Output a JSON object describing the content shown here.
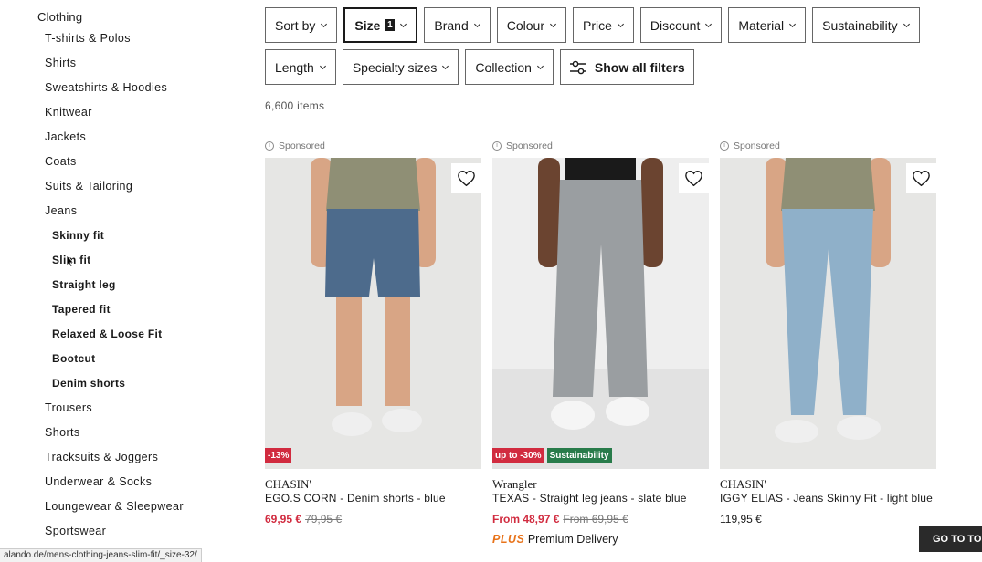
{
  "sidebar": {
    "root": "Clothing",
    "items": [
      {
        "label": "T-shirts & Polos",
        "sub": false
      },
      {
        "label": "Shirts",
        "sub": false
      },
      {
        "label": "Sweatshirts & Hoodies",
        "sub": false
      },
      {
        "label": "Knitwear",
        "sub": false
      },
      {
        "label": "Jackets",
        "sub": false
      },
      {
        "label": "Coats",
        "sub": false
      },
      {
        "label": "Suits & Tailoring",
        "sub": false
      },
      {
        "label": "Jeans",
        "sub": false
      },
      {
        "label": "Skinny fit",
        "sub": true
      },
      {
        "label": "Slim fit",
        "sub": true
      },
      {
        "label": "Straight leg",
        "sub": true
      },
      {
        "label": "Tapered fit",
        "sub": true
      },
      {
        "label": "Relaxed & Loose Fit",
        "sub": true
      },
      {
        "label": "Bootcut",
        "sub": true
      },
      {
        "label": "Denim shorts",
        "sub": true
      },
      {
        "label": "Trousers",
        "sub": false
      },
      {
        "label": "Shorts",
        "sub": false
      },
      {
        "label": "Tracksuits & Joggers",
        "sub": false
      },
      {
        "label": "Underwear & Socks",
        "sub": false
      },
      {
        "label": "Loungewear & Sleepwear",
        "sub": false
      },
      {
        "label": "Sportswear",
        "sub": false
      }
    ]
  },
  "filters": {
    "row1": [
      {
        "label": "Sort by",
        "active": false,
        "badge": ""
      },
      {
        "label": "Size",
        "active": true,
        "badge": "1"
      },
      {
        "label": "Brand",
        "active": false,
        "badge": ""
      },
      {
        "label": "Colour",
        "active": false,
        "badge": ""
      },
      {
        "label": "Price",
        "active": false,
        "badge": ""
      },
      {
        "label": "Discount",
        "active": false,
        "badge": ""
      },
      {
        "label": "Material",
        "active": false,
        "badge": ""
      },
      {
        "label": "Sustainability",
        "active": false,
        "badge": ""
      }
    ],
    "row2": [
      {
        "label": "Length"
      },
      {
        "label": "Specialty sizes"
      },
      {
        "label": "Collection"
      }
    ],
    "show_all": "Show all filters"
  },
  "item_count": "6,600 items",
  "products": [
    {
      "sponsored": "Sponsored",
      "brand": "CHASIN'",
      "name": "EGO.S CORN - Denim shorts - blue",
      "price_new": "69,95 €",
      "price_old": "79,95 €",
      "price_regular": "",
      "tags": [
        {
          "text": "-13%",
          "color": "red"
        }
      ],
      "plus": "",
      "plus_text": "",
      "style": "shorts",
      "colors": {
        "bg": "#e6e6e4",
        "shirt": "#8f8f75",
        "denim": "#4d6b8c",
        "skin": "#d8a585",
        "shoe": "#efefef"
      }
    },
    {
      "sponsored": "Sponsored",
      "brand": "Wrangler",
      "name": "TEXAS - Straight leg jeans - slate blue",
      "price_new": "From 48,97 €",
      "price_old": "From 69,95 €",
      "price_regular": "",
      "tags": [
        {
          "text": "up to -30%",
          "color": "red"
        },
        {
          "text": "Sustainability",
          "color": "green"
        }
      ],
      "plus": "PLUS",
      "plus_text": "Premium Delivery",
      "style": "straight",
      "colors": {
        "bg": "#eeeeee",
        "shirt": "#1a1a1a",
        "denim": "#9a9ea1",
        "skin": "#6b4430",
        "shoe": "#f5f5f5"
      }
    },
    {
      "sponsored": "Sponsored",
      "brand": "CHASIN'",
      "name": "IGGY ELIAS - Jeans Skinny Fit - light blue",
      "price_new": "",
      "price_old": "",
      "price_regular": "119,95 €",
      "tags": [],
      "plus": "",
      "plus_text": "",
      "style": "skinny",
      "colors": {
        "bg": "#e6e6e4",
        "shirt": "#8f8f75",
        "denim": "#8fb0c9",
        "skin": "#d8a585",
        "shoe": "#efefef"
      }
    }
  ],
  "status_url": "alando.de/mens-clothing-jeans-slim-fit/_size-32/",
  "go_to_top": "GO TO TOP"
}
